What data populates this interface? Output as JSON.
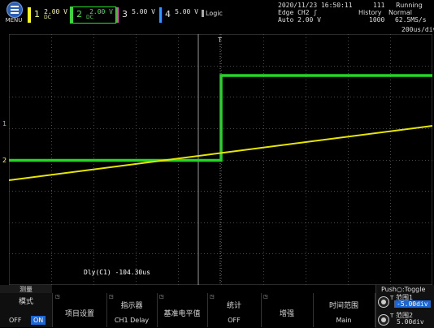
{
  "header": {
    "menu_label": "MENU",
    "channels": [
      {
        "num": "1",
        "scale": "2.00 V",
        "coupling": "DC",
        "color": "#ffff00"
      },
      {
        "num": "2",
        "scale": "2.00 V",
        "coupling": "DC",
        "color": "#2be22b"
      },
      {
        "num": "3",
        "scale": "5.00 V",
        "coupling": "",
        "color": "#ff3ccc"
      },
      {
        "num": "4",
        "scale": "5.00 V",
        "coupling": "",
        "color": "#3399ff"
      }
    ],
    "logic_label": "Logic",
    "datetime": "2020/11/23 16:50:11",
    "trigger_info": "Edge CH2 ʃ",
    "trigger_level": "Auto 2.00 V",
    "acq_count": "111",
    "run_status": "Running",
    "history_label": "History",
    "acq_mode": "Normal",
    "record_length": "1000",
    "sample_rate": "62.5MS/s",
    "timebase": "200us/div"
  },
  "waveform": {
    "measurement": "Dly(C1) -104.30us",
    "ch1_marker": "1",
    "ch2_marker": "2",
    "trigger_marker": "T"
  },
  "softkeys": {
    "measure_header": "测量",
    "mode": {
      "title": "模式",
      "off": "OFF",
      "on": "ON"
    },
    "items_setup": {
      "title": "项目设置"
    },
    "indicator": {
      "title": "指示器",
      "value": "CH1 Delay"
    },
    "ref_level": {
      "title": "基准电平值"
    },
    "statistics": {
      "title": "统计",
      "value": "OFF"
    },
    "enhance": {
      "title": "增强"
    },
    "time_range": {
      "title": "时间范围",
      "value": "Main"
    },
    "push_toggle": "Push○:Toggle",
    "range1": {
      "label": "范围1",
      "value": "-5.00div"
    },
    "range2": {
      "label": "范围2",
      "value": "5.00div"
    }
  }
}
